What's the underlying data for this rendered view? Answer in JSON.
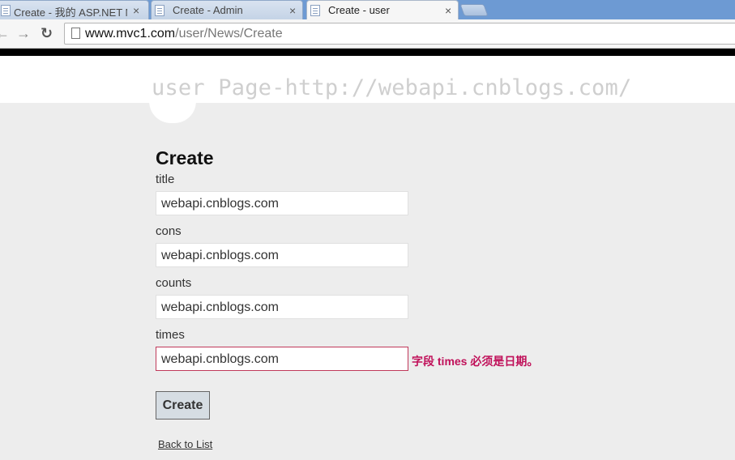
{
  "browser": {
    "tabs": [
      {
        "title": "Create - 我的 ASP.NET M",
        "active": false
      },
      {
        "title": "Create - Admin",
        "active": false
      },
      {
        "title": "Create - user",
        "active": true
      }
    ],
    "close_glyph": "×",
    "back_glyph": "←",
    "forward_glyph": "→",
    "reload_glyph": "↻",
    "url_host": "www.mvc1.com",
    "url_path": "/user/News/Create"
  },
  "header": {
    "site_title": "user Page-http://webapi.cnblogs.com/"
  },
  "form": {
    "title": "Create",
    "fields": [
      {
        "label": "title",
        "value": "webapi.cnblogs.com"
      },
      {
        "label": "cons",
        "value": "webapi.cnblogs.com"
      },
      {
        "label": "counts",
        "value": "webapi.cnblogs.com"
      },
      {
        "label": "times",
        "value": "webapi.cnblogs.com",
        "error": "字段 times 必须是日期。"
      }
    ],
    "submit_label": "Create",
    "back_link": "Back to List"
  },
  "colors": {
    "error": "#c0115a",
    "page_bg": "#ededed",
    "tabstrip": "#6d9ad3"
  }
}
